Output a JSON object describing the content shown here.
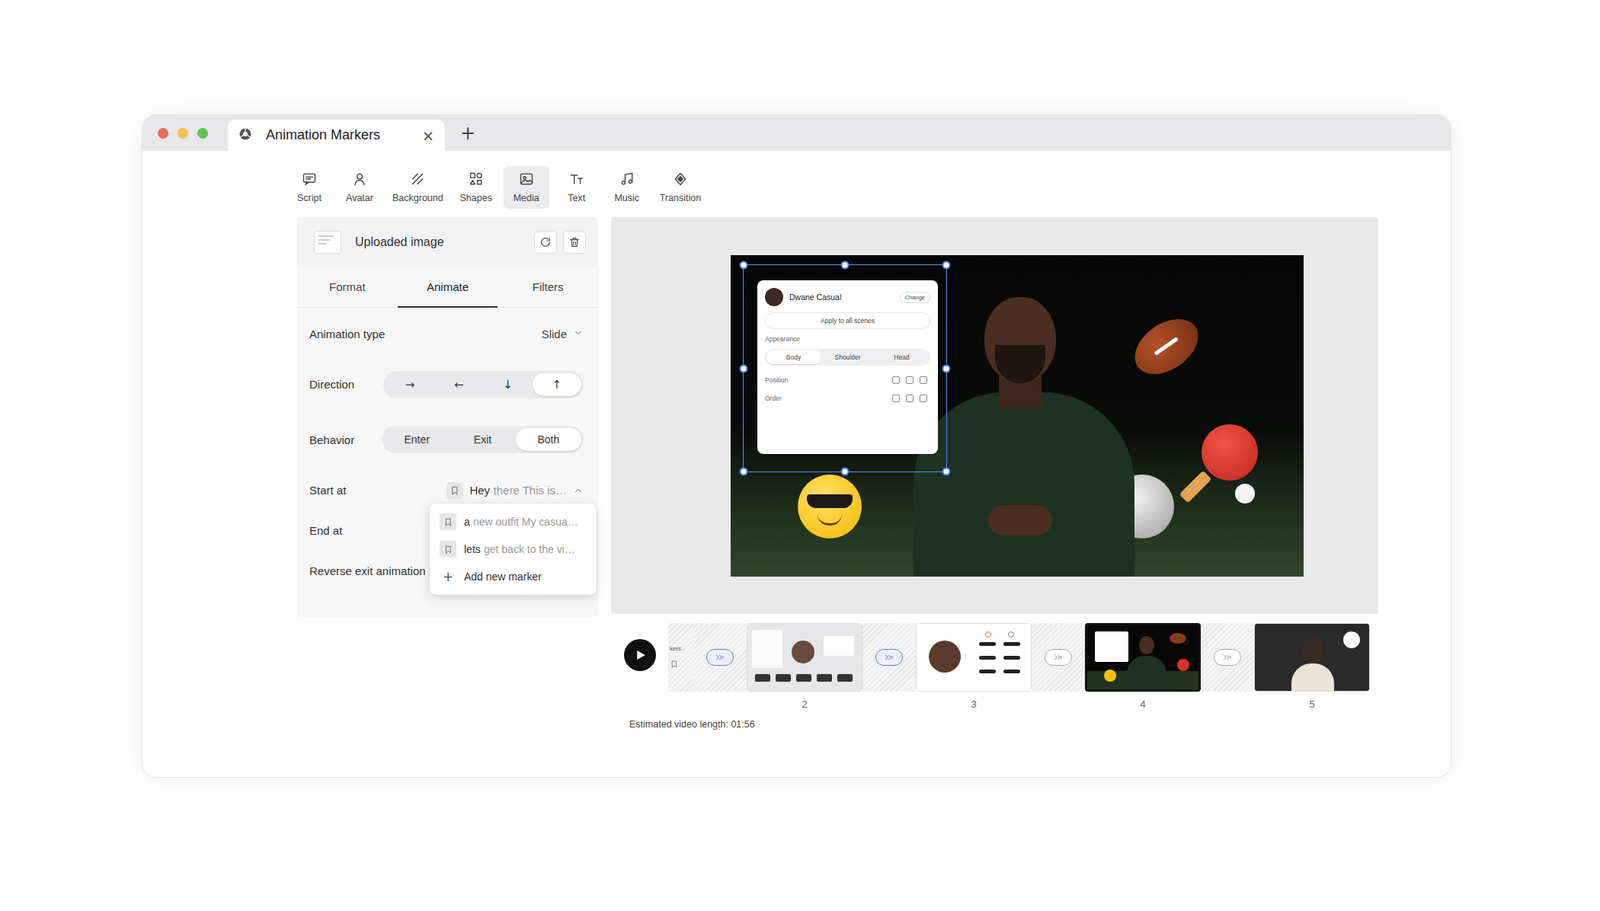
{
  "window": {
    "title": "Animation Markers",
    "close": "×",
    "new_tab": "+"
  },
  "toolbar": [
    {
      "label": "Script",
      "kind": "script",
      "selected": false
    },
    {
      "label": "Avatar",
      "kind": "avatar",
      "selected": false
    },
    {
      "label": "Background",
      "kind": "background",
      "selected": false
    },
    {
      "label": "Shapes",
      "kind": "shapes",
      "selected": false
    },
    {
      "label": "Media",
      "kind": "media",
      "selected": true
    },
    {
      "label": "Text",
      "kind": "text",
      "selected": false
    },
    {
      "label": "Music",
      "kind": "music",
      "selected": false
    },
    {
      "label": "Transition",
      "kind": "transition",
      "selected": false
    }
  ],
  "panel": {
    "header": {
      "title": "Uploaded image"
    },
    "tabs": [
      {
        "label": "Format",
        "selected": false
      },
      {
        "label": "Animate",
        "selected": true
      },
      {
        "label": "Filters",
        "selected": false
      }
    ],
    "animation_type": {
      "label": "Animation type",
      "value": "Slide"
    },
    "direction": {
      "label": "Direction",
      "options": [
        {
          "label": "→",
          "selected": false
        },
        {
          "label": "←",
          "selected": false
        },
        {
          "label": "↓",
          "selected": false
        },
        {
          "label": "↑",
          "selected": true
        }
      ]
    },
    "behavior": {
      "label": "Behavior",
      "options": [
        {
          "label": "Enter",
          "selected": false
        },
        {
          "label": "Exit",
          "selected": false
        },
        {
          "label": "Both",
          "selected": true
        }
      ]
    },
    "start_at": {
      "label": "Start at",
      "lead": "Hey",
      "rest": "there This is…",
      "expanded": true
    },
    "end_at": {
      "label": "End at"
    },
    "reverse_exit": {
      "label": "Reverse exit animation"
    },
    "marker_menu": {
      "items": [
        {
          "kind": "marker",
          "lead": "a",
          "rest": "new outfit My casua…"
        },
        {
          "kind": "marker",
          "lead": "lets",
          "rest": "get back to the vi…"
        },
        {
          "kind": "add",
          "icon": "+",
          "label": "Add new marker"
        }
      ]
    }
  },
  "canvas": {
    "selected": true,
    "card": {
      "name": "Dwane Casual",
      "change": "Change",
      "apply": "Apply to all scenes",
      "appearance": "Appearance",
      "segments": [
        {
          "label": "Body",
          "selected": true
        },
        {
          "label": "Shoulder",
          "selected": false
        },
        {
          "label": "Head",
          "selected": false
        }
      ],
      "position": "Position",
      "order": "Order"
    }
  },
  "timeline": {
    "partial_text": "kers",
    "transitions": [
      {
        "active": true
      },
      {
        "active": true
      },
      {
        "active": false
      },
      {
        "active": false
      }
    ],
    "scenes": [
      {
        "number": "2",
        "kind": "slides",
        "selected": false
      },
      {
        "number": "3",
        "kind": "icons",
        "selected": false
      },
      {
        "number": "4",
        "kind": "sports",
        "selected": true
      },
      {
        "number": "5",
        "kind": "portrait",
        "selected": false
      }
    ],
    "estimate": "Estimated video length: 01:56"
  }
}
